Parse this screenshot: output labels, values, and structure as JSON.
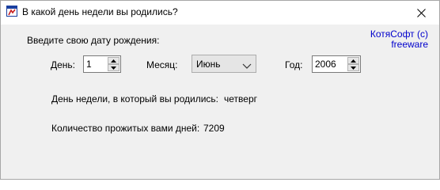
{
  "window": {
    "title": "В какой день недели вы родились?"
  },
  "copyright": {
    "line1": "КотяСофт (c)",
    "line2": "freeware"
  },
  "form": {
    "prompt": "Введите свою дату рождения:",
    "day_label": "День:",
    "day_value": "1",
    "month_label": "Месяц:",
    "month_value": "Июнь",
    "year_label": "Год:",
    "year_value": "2006"
  },
  "results": {
    "weekday_label": "День недели, в который вы родились:",
    "weekday_value": "четверг",
    "days_label": "Количество прожитых вами дней:",
    "days_value": "7209"
  },
  "icons": {
    "app": "calendar-app-icon",
    "close": "close-icon",
    "spin_up": "triangle-up-icon",
    "spin_down": "triangle-down-icon",
    "dropdown": "chevron-down-icon"
  }
}
